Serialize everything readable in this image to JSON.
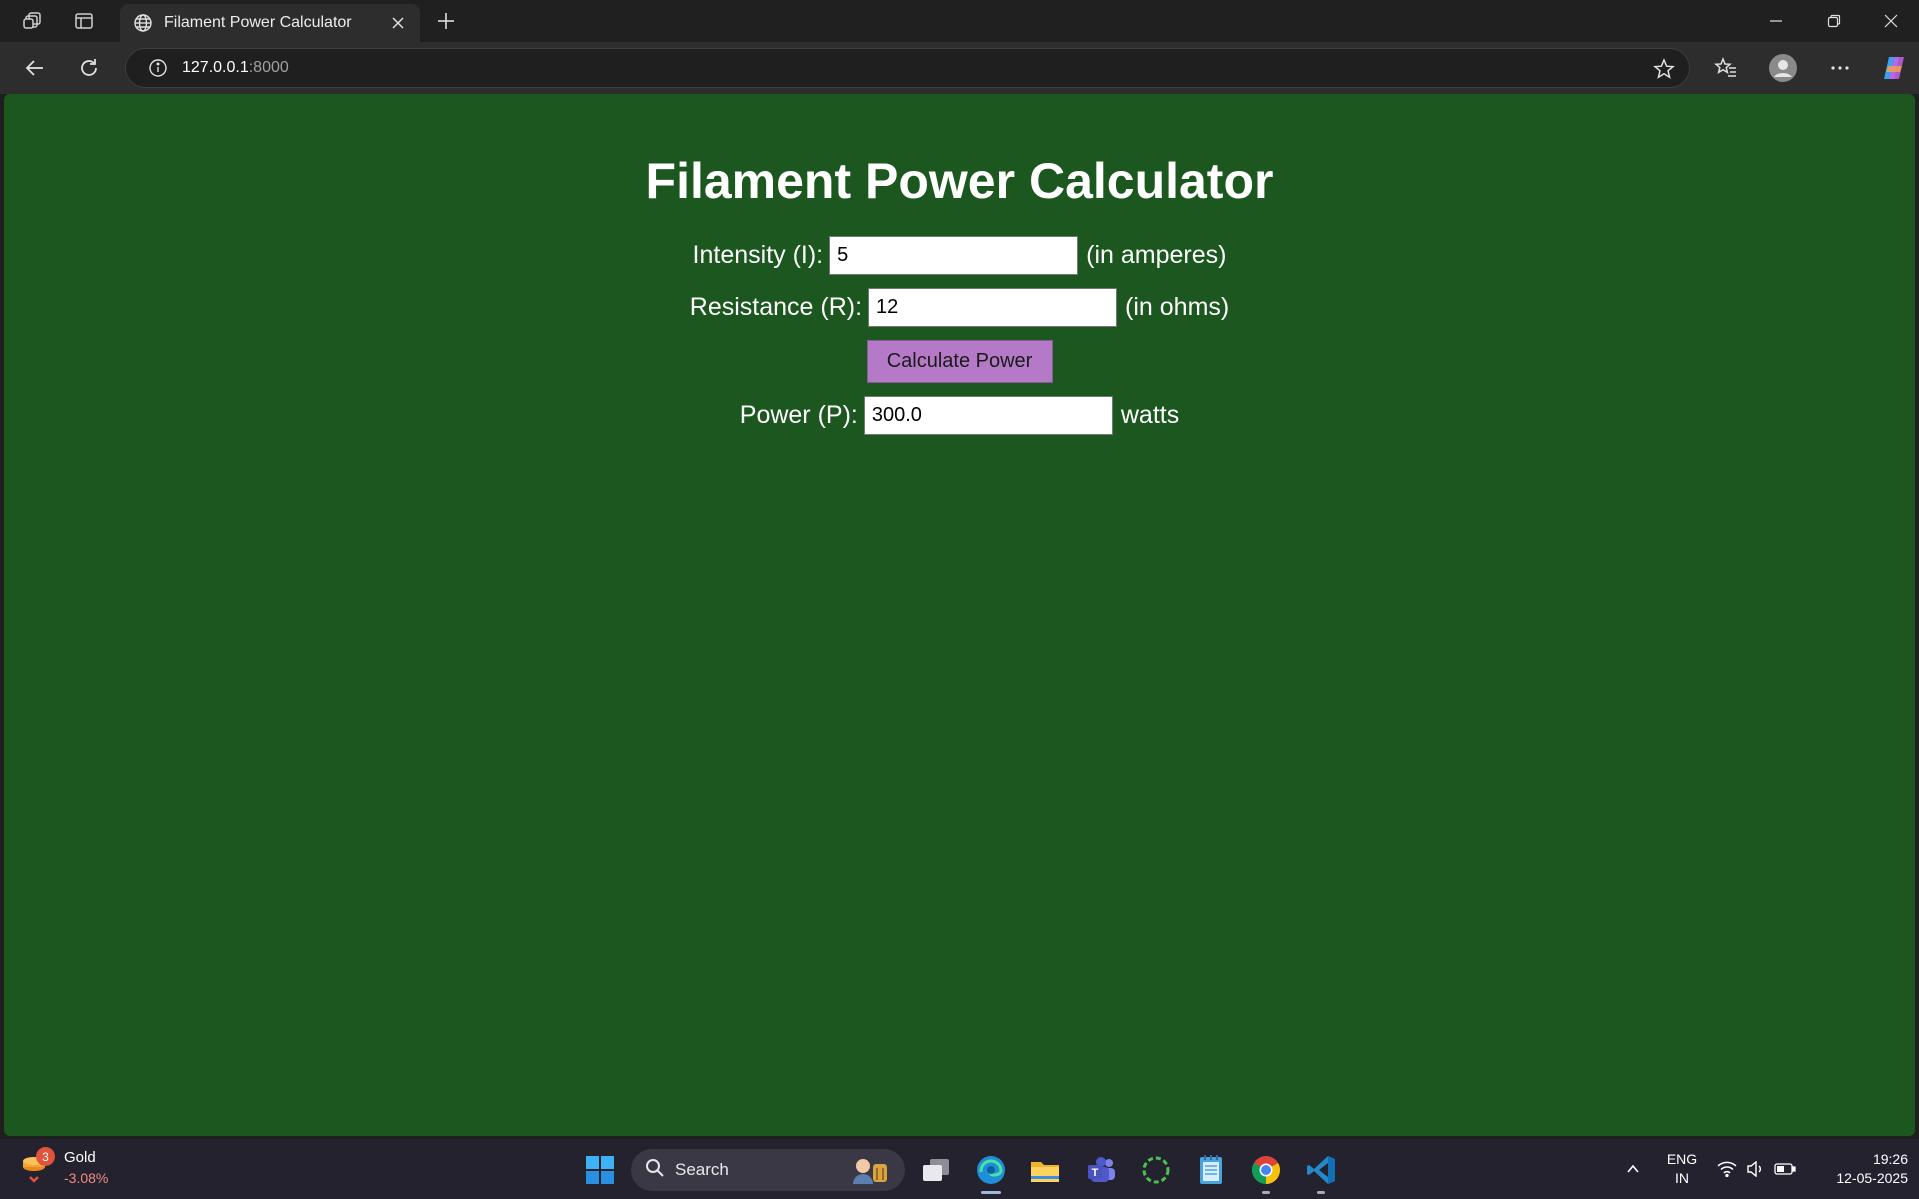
{
  "browser": {
    "tab_title": "Filament Power Calculator",
    "url_host": "127.0.0.1",
    "url_port": ":8000"
  },
  "page": {
    "title": "Filament Power Calculator",
    "intensity_label": "Intensity (I):",
    "intensity_value": "5",
    "intensity_unit": "(in amperes)",
    "resistance_label": "Resistance (R):",
    "resistance_value": "12",
    "resistance_unit": "(in ohms)",
    "button_label": "Calculate Power",
    "power_label": "Power (P):",
    "power_value": "300.0",
    "power_unit": "watts",
    "background_color": "#1b571f",
    "button_color": "#b57ac7"
  },
  "taskbar": {
    "widget_name": "Gold",
    "widget_change": "-3.08%",
    "widget_badge": "3",
    "search_label": "Search",
    "lang_line1": "ENG",
    "lang_line2": "IN",
    "time": "19:26",
    "date": "12-05-2025"
  }
}
